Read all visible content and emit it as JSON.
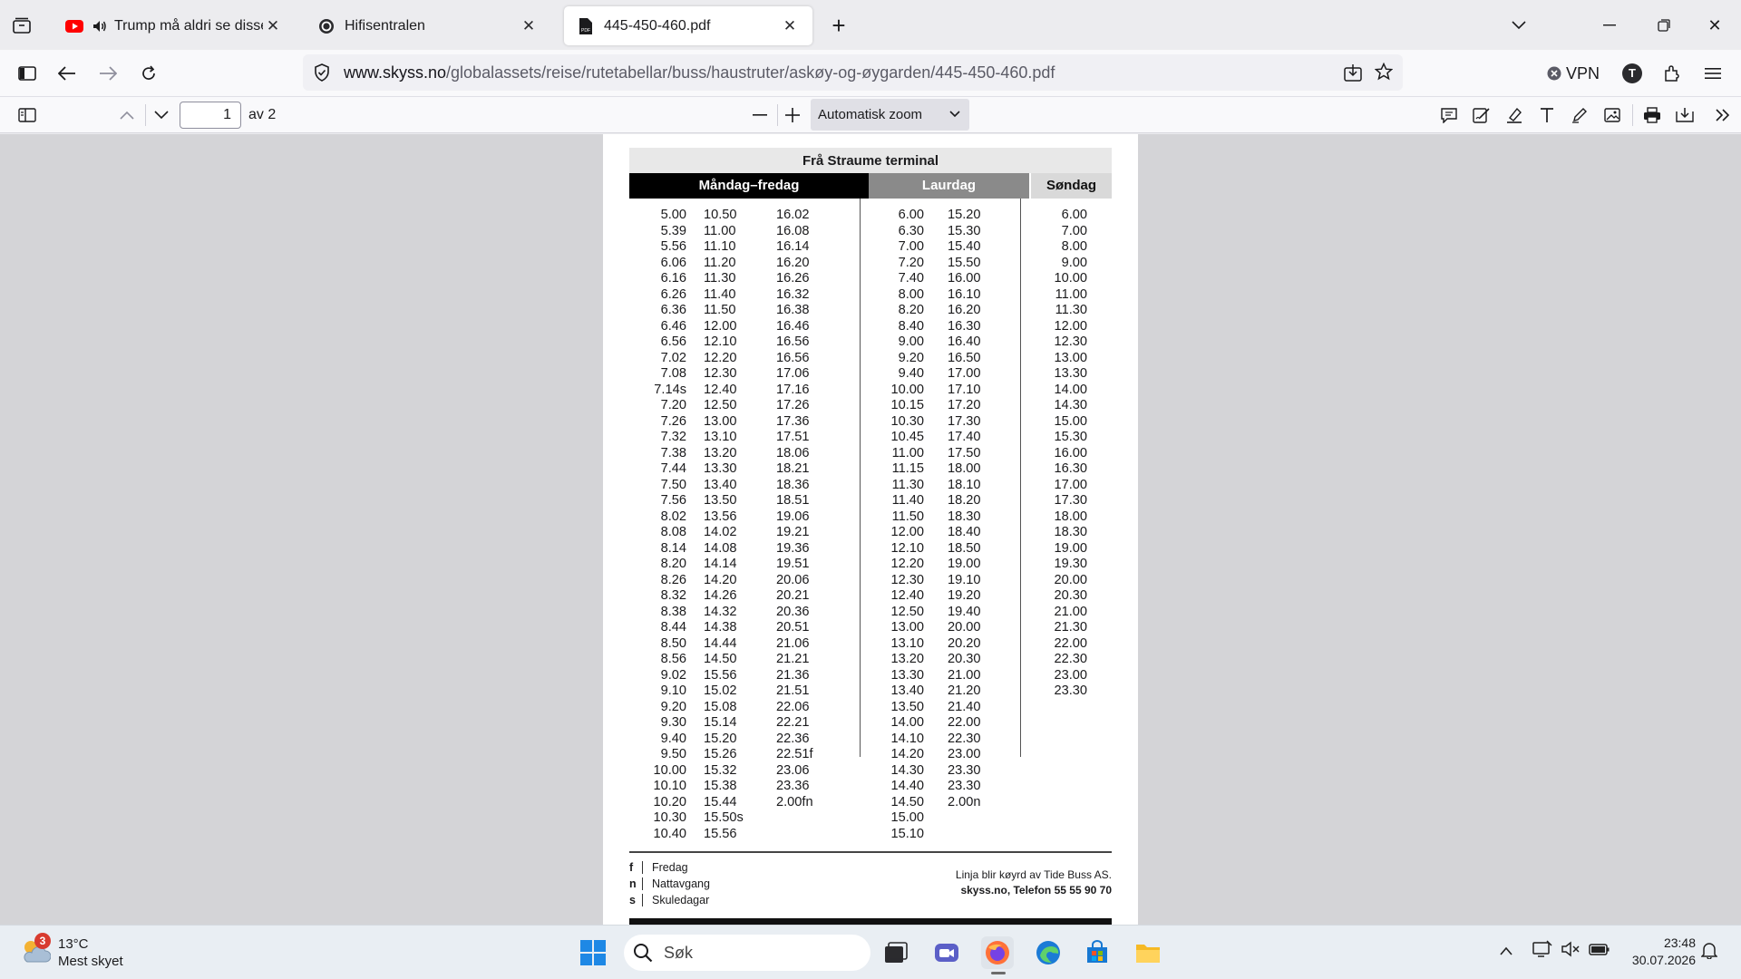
{
  "tabs": [
    {
      "title": "Trump må aldri se disse pol",
      "favicon": "youtube-icon",
      "audio": true
    },
    {
      "title": "Hifisentralen",
      "favicon": "site-icon"
    },
    {
      "title": "445-450-460.pdf",
      "favicon": "pdf-icon",
      "active": true
    }
  ],
  "navbar": {
    "url_domain": "www.skyss.no",
    "url_path": "/globalassets/reise/rutetabellar/buss/haustruter/askøy-og-øygarden/445-450-460.pdf",
    "vpn_label": "VPN",
    "avatar_initial": "T"
  },
  "pdf_toolbar": {
    "page_number": "1",
    "page_total": "av 2",
    "zoom_label": "Automatisk zoom"
  },
  "timetable": {
    "title": "Frå Straume terminal",
    "headers": {
      "weekday": "Måndag–fredag",
      "saturday": "Laurdag",
      "sunday": "Søndag"
    },
    "weekday_col1": [
      "5.00",
      "5.39",
      "5.56",
      "6.06",
      "6.16",
      "6.26",
      "6.36",
      "6.46",
      "6.56",
      "7.02",
      "7.08",
      "7.14s",
      "7.20",
      "7.26",
      "7.32",
      "7.38",
      "7.44",
      "7.50",
      "7.56",
      "8.02",
      "8.08",
      "8.14",
      "8.20",
      "8.26",
      "8.32",
      "8.38",
      "8.44",
      "8.50",
      "8.56",
      "9.02",
      "9.10",
      "9.20",
      "9.30",
      "9.40",
      "9.50",
      "10.00",
      "10.10",
      "10.20",
      "10.30",
      "10.40"
    ],
    "weekday_col2": [
      "10.50",
      "11.00",
      "11.10",
      "11.20",
      "11.30",
      "11.40",
      "11.50",
      "12.00",
      "12.10",
      "12.20",
      "12.30",
      "12.40",
      "12.50",
      "13.00",
      "13.10",
      "13.20",
      "13.30",
      "13.40",
      "13.50",
      "13.56",
      "14.02",
      "14.08",
      "14.14",
      "14.20",
      "14.26",
      "14.32",
      "14.38",
      "14.44",
      "14.50",
      "15.56",
      "15.02",
      "15.08",
      "15.14",
      "15.20",
      "15.26",
      "15.32",
      "15.38",
      "15.44",
      "15.50s",
      "15.56"
    ],
    "weekday_col3": [
      "16.02",
      "16.08",
      "16.14",
      "16.20",
      "16.26",
      "16.32",
      "16.38",
      "16.46",
      "16.56",
      "16.56",
      "17.06",
      "17.16",
      "17.26",
      "17.36",
      "17.51",
      "18.06",
      "18.21",
      "18.36",
      "18.51",
      "19.06",
      "19.21",
      "19.36",
      "19.51",
      "20.06",
      "20.21",
      "20.36",
      "20.51",
      "21.06",
      "21.21",
      "21.36",
      "21.51",
      "22.06",
      "22.21",
      "22.36",
      "22.51f",
      "23.06",
      "23.36",
      "2.00fn"
    ],
    "saturday_col1": [
      "6.00",
      "6.30",
      "7.00",
      "7.20",
      "7.40",
      "8.00",
      "8.20",
      "8.40",
      "9.00",
      "9.20",
      "9.40",
      "10.00",
      "10.15",
      "10.30",
      "10.45",
      "11.00",
      "11.15",
      "11.30",
      "11.40",
      "11.50",
      "12.00",
      "12.10",
      "12.20",
      "12.30",
      "12.40",
      "12.50",
      "13.00",
      "13.10",
      "13.20",
      "13.30",
      "13.40",
      "13.50",
      "14.00",
      "14.10",
      "14.20",
      "14.30",
      "14.40",
      "14.50",
      "15.00",
      "15.10"
    ],
    "saturday_col2": [
      "15.20",
      "15.30",
      "15.40",
      "15.50",
      "16.00",
      "16.10",
      "16.20",
      "16.30",
      "16.40",
      "16.50",
      "17.00",
      "17.10",
      "17.20",
      "17.30",
      "17.40",
      "17.50",
      "18.00",
      "18.10",
      "18.20",
      "18.30",
      "18.40",
      "18.50",
      "19.00",
      "19.10",
      "19.20",
      "19.40",
      "20.00",
      "20.20",
      "20.30",
      "21.00",
      "21.20",
      "21.40",
      "22.00",
      "22.30",
      "23.00",
      "23.30",
      "23.30",
      "2.00n"
    ],
    "sunday_col": [
      "6.00",
      "7.00",
      "8.00",
      "9.00",
      "10.00",
      "11.00",
      "11.30",
      "12.00",
      "12.30",
      "13.00",
      "13.30",
      "14.00",
      "14.30",
      "15.00",
      "15.30",
      "16.00",
      "16.30",
      "17.00",
      "17.30",
      "18.00",
      "18.30",
      "19.00",
      "19.30",
      "20.00",
      "20.30",
      "21.00",
      "21.30",
      "22.00",
      "22.30",
      "23.00",
      "23.30"
    ],
    "legend": [
      {
        "key": "f",
        "text": "Fredag"
      },
      {
        "key": "n",
        "text": "Nattavgang"
      },
      {
        "key": "s",
        "text": "Skuledagar"
      }
    ],
    "operator_line1": "Linja blir køyrd av Tide Buss AS.",
    "operator_line2": "skyss.no, Telefon 55 55 90 70"
  },
  "taskbar": {
    "weather_temp": "13°C",
    "weather_desc": "Mest skyet",
    "weather_badge": "3",
    "search_placeholder": "Søk",
    "time": "23:48",
    "date": "30.07.2026"
  },
  "colors": {
    "tab_strip": "#ececef",
    "toolbar": "#f9f9fb",
    "viewer_bg": "#d4d4d7",
    "weekday_header": "#000000",
    "saturday_header": "#8a8a8a",
    "sunday_header": "#d9d9d9",
    "taskbar": "#e9eef3"
  }
}
